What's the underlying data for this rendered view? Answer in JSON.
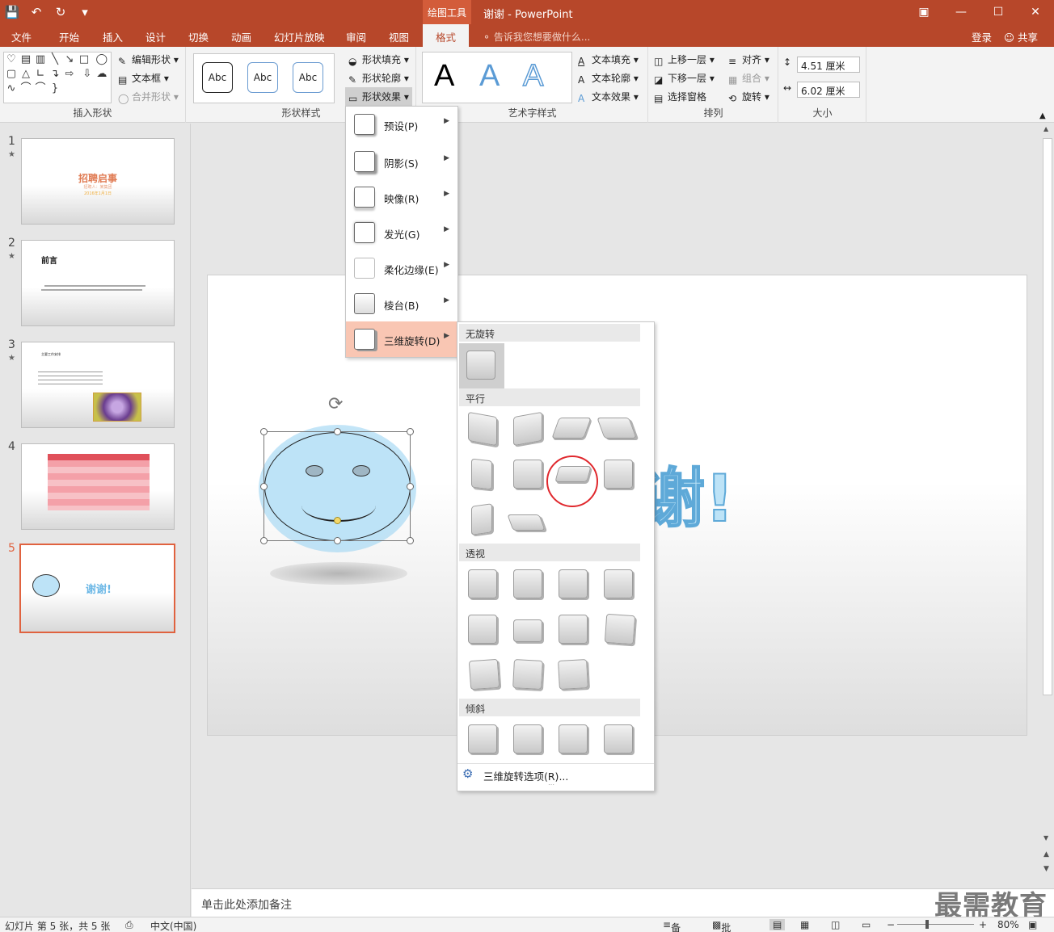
{
  "window": {
    "context_tab_group": "绘图工具",
    "doc_title": "谢谢 - PowerPoint",
    "login": "登录",
    "share": "共享"
  },
  "tabs": [
    "文件",
    "开始",
    "插入",
    "设计",
    "切换",
    "动画",
    "幻灯片放映",
    "审阅",
    "视图",
    "格式"
  ],
  "active_tab": "格式",
  "tell_me": "告诉我您想要做什么...",
  "ribbon": {
    "insert_shapes": {
      "edit_shape": "编辑形状",
      "text_box": "文本框",
      "merge_shapes": "合并形状",
      "label": "插入形状"
    },
    "shape_styles": {
      "samples": [
        "Abc",
        "Abc",
        "Abc"
      ],
      "fill": "形状填充",
      "outline": "形状轮廓",
      "effects": "形状效果",
      "label": "形状样式"
    },
    "wordart": {
      "samples": [
        "A",
        "A",
        "A"
      ],
      "text_fill": "文本填充",
      "text_outline": "文本轮廓",
      "text_effects": "文本效果",
      "label": "艺术字样式"
    },
    "arrange": {
      "bring_forward": "上移一层",
      "send_backward": "下移一层",
      "selection_pane": "选择窗格",
      "align": "对齐",
      "group": "组合",
      "rotate": "旋转",
      "label": "排列"
    },
    "size": {
      "height": "4.51 厘米",
      "width": "6.02 厘米",
      "label": "大小"
    }
  },
  "slides": [
    {
      "num": "1",
      "star": "★",
      "title": "招聘启事",
      "sub1": "招聘人：某集团",
      "sub2": "2016年1月1日"
    },
    {
      "num": "2",
      "star": "★",
      "title": "前言"
    },
    {
      "num": "3",
      "star": "★",
      "title": "主要工作安排"
    },
    {
      "num": "4",
      "star": ""
    },
    {
      "num": "5",
      "star": "",
      "title": "谢谢!"
    }
  ],
  "slide_text": "谢!",
  "menu": {
    "items": [
      {
        "label": "预设(P)"
      },
      {
        "label": "阴影(S)"
      },
      {
        "label": "映像(R)"
      },
      {
        "label": "发光(G)"
      },
      {
        "label": "柔化边缘(E)"
      },
      {
        "label": "棱台(B)"
      },
      {
        "label": "三维旋转(D)"
      }
    ],
    "active_index": 6
  },
  "submenu": {
    "sections": [
      "无旋转",
      "平行",
      "透视",
      "倾斜"
    ],
    "options_label": "三维旋转选项(R)...",
    "highlighted_tile": "平行-7"
  },
  "notes_placeholder": "单击此处添加备注",
  "watermark": "最需教育",
  "status": {
    "slide_info": "幻灯片 第 5 张，共 5 张",
    "language": "中文(中国)",
    "notes": "备注",
    "comments": "批注",
    "zoom": "80%"
  },
  "colors": {
    "accent": "#b7472a",
    "menu_highlight": "#f9c6b3",
    "smiley_fill": "#bde3f7",
    "circle_mark": "#e0282d"
  }
}
